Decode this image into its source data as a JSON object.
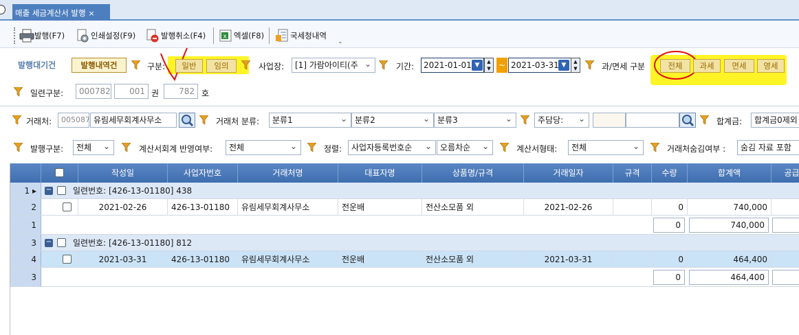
{
  "window": {
    "tab_title": "매출 세금계산서 발행",
    "tab_close": "×"
  },
  "toolbar": {
    "issue": "발행(F7)",
    "print_settings": "인쇄설정(F9)",
    "cancel_issue": "발행취소(F4)",
    "excel": "엑셀(F8)",
    "nts_history": "국세청내역"
  },
  "filters": {
    "period_label": "발행대기건",
    "history_button": "발행내역건",
    "type_label": "구분:",
    "type_general": "일반",
    "type_arbitrary": "임의",
    "business_label": "사업장:",
    "business_value": "[1] 가람아이티(주",
    "period_date_label": "기간:",
    "date_from": "2021-01-01",
    "date_tilde": "~",
    "date_to": "2021-03-31",
    "tax_type_label": "과/면세 구분",
    "tax_all": "전체",
    "tax_taxable": "과세",
    "tax_exempt": "면세",
    "tax_zero": "영세",
    "serial_label": "일련구분:",
    "serial_value": "000782",
    "book_value": "001",
    "book_unit": "권",
    "number_value": "782",
    "number_unit": "호",
    "client_label": "거래처:",
    "client_code": "005087",
    "client_name": "유림세무회계사무소",
    "client_class_label": "거래처 분류:",
    "class1": "분류1",
    "class2": "분류2",
    "class3": "분류3",
    "manager_label": "주담당:",
    "total_label": "합계금:",
    "total_value": "합계금0제외",
    "issue_type_label": "발행구분:",
    "issue_type_value": "전체",
    "accounting_label": "계산서회계 반영여부:",
    "accounting_value": "전체",
    "sort_label": "정렬:",
    "sort_value": "사업자등록번호순",
    "order_value": "오름차순",
    "invoice_type_label": "계산서형태:",
    "invoice_type_value": "전체",
    "hide_label": "거래처숨김여부 :",
    "hide_value": "숨김 자료 포함"
  },
  "grid": {
    "headers": [
      "작성일",
      "사업자번호",
      "거래처명",
      "대표자명",
      "상품명/규격",
      "거래일자",
      "규격",
      "수량",
      "합계액",
      "공급"
    ],
    "rows": [
      {
        "kind": "group",
        "rownum": "1",
        "text": "일련번호: [426-13-01180] 438"
      },
      {
        "kind": "data",
        "rownum": "2",
        "date": "2021-02-26",
        "biz": "426-13-01180",
        "client": "유림세무회계사무소",
        "ceo": "전운배",
        "item": "전산소모품 외",
        "trade_date": "2021-02-26",
        "spec": "",
        "qty": "0",
        "total": "740,000"
      },
      {
        "kind": "sub",
        "rownum": "1",
        "qty": "0",
        "total": "740,000"
      },
      {
        "kind": "group",
        "rownum": "3",
        "text": "일련번호: [426-13-01180] 812"
      },
      {
        "kind": "data",
        "rownum": "4",
        "date": "2021-03-31",
        "biz": "426-13-01180",
        "client": "유림세무회계사무소",
        "ceo": "전운배",
        "item": "전산소모품 외",
        "trade_date": "2021-03-31",
        "spec": "",
        "qty": "0",
        "total": "464,400"
      },
      {
        "kind": "sub",
        "rownum": "3",
        "qty": "0",
        "total": "464,400"
      }
    ]
  },
  "colors": {
    "header_blue": "#3f6eaf",
    "highlight_yellow": "#fff200",
    "annotation_red": "#e01010"
  }
}
